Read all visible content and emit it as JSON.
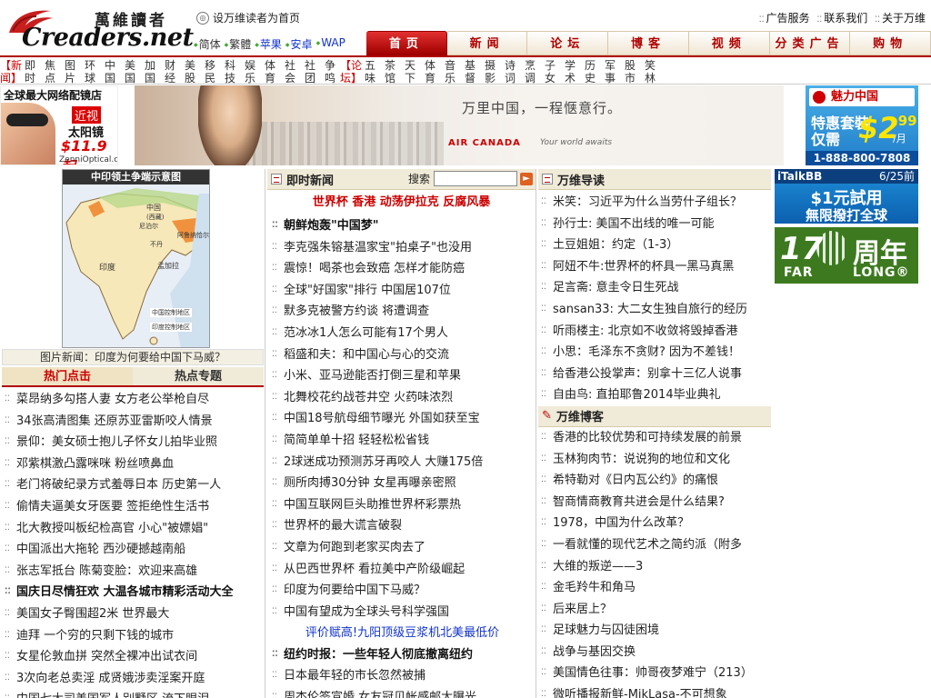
{
  "header": {
    "logo_cn": "萬維讀者",
    "logo_en": "Creaders.net",
    "set_home": "设万维读者为首页",
    "top_links": [
      "广告服务",
      "联系我们",
      "关于万维"
    ],
    "languages": [
      {
        "label": "简体",
        "color": "#333333"
      },
      {
        "label": "繁體",
        "color": "#333333"
      },
      {
        "label": "苹果",
        "color": "#1133cc"
      },
      {
        "label": "安卓",
        "color": "#1133cc"
      },
      {
        "label": "WAP",
        "color": "#1133cc"
      }
    ],
    "main_nav": [
      "首页",
      "新闻",
      "论坛",
      "博客",
      "视频",
      "分类广告",
      "购物"
    ],
    "active_nav": "首页"
  },
  "subnav": [
    {
      "label": "【新闻】",
      "red": true
    },
    {
      "label": "即时",
      "red": false
    },
    {
      "label": "焦点",
      "red": false
    },
    {
      "label": "图片",
      "red": false
    },
    {
      "label": "环球",
      "red": false
    },
    {
      "label": "中国",
      "red": false
    },
    {
      "label": "美国",
      "red": false
    },
    {
      "label": "加国",
      "red": false
    },
    {
      "label": "财经",
      "red": false
    },
    {
      "label": "美股",
      "red": false
    },
    {
      "label": "移民",
      "red": false
    },
    {
      "label": "科技",
      "red": false
    },
    {
      "label": "娱乐",
      "red": false
    },
    {
      "label": "体育",
      "red": false
    },
    {
      "label": "社会",
      "red": false
    },
    {
      "label": "社团",
      "red": false
    },
    {
      "label": "争鸣",
      "red": false
    },
    {
      "label": "【论坛】",
      "red": true
    },
    {
      "label": "五味",
      "red": false
    },
    {
      "label": "茶馆",
      "red": false
    },
    {
      "label": "天下",
      "red": false
    },
    {
      "label": "体育",
      "red": false
    },
    {
      "label": "音乐",
      "red": false
    },
    {
      "label": "基督",
      "red": false
    },
    {
      "label": "摄影",
      "red": false
    },
    {
      "label": "诗词",
      "red": false
    },
    {
      "label": "烹调",
      "red": false
    },
    {
      "label": "子女",
      "red": false
    },
    {
      "label": "学术",
      "red": false
    },
    {
      "label": "历史",
      "red": false
    },
    {
      "label": "军事",
      "red": false
    },
    {
      "label": "股市",
      "red": false
    },
    {
      "label": "笑林",
      "red": false
    }
  ],
  "ads": {
    "glasses": {
      "title": "全球最大网络配镜店",
      "near": "近视",
      "sun": "太阳镜",
      "price": "$11.9 起",
      "site": "ZenniOptical.com"
    },
    "aircanada": {
      "slogan": "万里中国，一程惬意行。",
      "brand": "AIR CANADA",
      "tagline": "Your world awaits"
    },
    "phone": {
      "logo": "魅力中国",
      "l1": "特惠套裝",
      "l2": "仅需",
      "price": "$2",
      "cents": ".99",
      "unit": "/月",
      "tel": "1-888-800-7808"
    },
    "italk": {
      "title": "iTalkBB",
      "date": "6/25前",
      "l1": "$1元試用",
      "l2": "無限撥打全球"
    },
    "farlong": {
      "num": "17",
      "year": "周年",
      "far": "FAR",
      "long": "LONG®"
    }
  },
  "left": {
    "map_title": "中印领土争端示意图",
    "map_labels": [
      "中国",
      "(西藏)",
      "印度",
      "孟加拉",
      "尼泊尔",
      "不丹",
      "阿鲁纳恰尔邦",
      "斯里兰卡",
      "巴基斯坦",
      "阿克赛钦"
    ],
    "map_legend": [
      "中国控制地区",
      "印度控制地区"
    ],
    "caption": "图片新闻：印度为何要给中国下马威？",
    "tabs": [
      "热门点击",
      "热点专题"
    ],
    "items": [
      {
        "text": "菜昂纳多勾搭人妻 女方老公举枪自尽",
        "bold": false
      },
      {
        "text": "34张高清图集 还原苏亚雷斯咬人情景",
        "bold": false
      },
      {
        "text": "景仰：美女硕士抱儿子怀女儿拍毕业照",
        "bold": false
      },
      {
        "text": "邓紫棋激凸露咪咪 粉丝喷鼻血",
        "bold": false
      },
      {
        "text": "老门将破纪录方式羞辱日本 历史第一人",
        "bold": false
      },
      {
        "text": "偷情夫逼美女牙医要 签拒绝性生活书",
        "bold": false
      },
      {
        "text": "北大教授叫板纪检高官 小心\"被嫖娼\"",
        "bold": false
      },
      {
        "text": "中国派出大拖轮 西沙硬撼越南船",
        "bold": false
      },
      {
        "text": "张志军抵台 陈菊变脸：欢迎来高雄",
        "bold": false
      },
      {
        "text": "国庆日尽情狂欢 大温各城市精彩活动大全",
        "bold": true
      },
      {
        "text": "美国女子臀围超2米 世界最大",
        "bold": false
      },
      {
        "text": "迪拜 一个穷的只剩下钱的城市",
        "bold": false
      },
      {
        "text": "女星伦敦血拼 突然全裸冲出试衣间",
        "bold": false
      },
      {
        "text": "3次向老总卖淫 成贤娥涉卖淫案开庭",
        "bold": false
      },
      {
        "text": "中国七大司美国军人别墅区 流下眼泪",
        "bold": false
      }
    ]
  },
  "center": {
    "header": "即时新闻",
    "search_label": "搜索",
    "search_placeholder": "",
    "hotline": "世界杯 香港 动荡伊拉克 反腐风暴",
    "items": [
      {
        "text": "朝鲜炮轰\"中国梦\"",
        "style": "b"
      },
      {
        "text": "李克强朱镕基温家宝\"拍桌子\"也没用",
        "style": ""
      },
      {
        "text": "震惊！喝茶也会致癌 怎样才能防癌",
        "style": ""
      },
      {
        "text": "全球\"好国家\"排行 中国居107位",
        "style": ""
      },
      {
        "text": "默多克被警方约谈 将遭调查",
        "style": ""
      },
      {
        "text": "范冰冰1人怎么可能有17个男人",
        "style": ""
      },
      {
        "text": "稻盛和夫：和中国心与心的交流",
        "style": ""
      },
      {
        "text": "小米、亚马逊能否打倒三星和苹果",
        "style": ""
      },
      {
        "text": "北舞校花约战苍井空 火药味浓烈",
        "style": ""
      },
      {
        "text": "中国18号航母细节曝光 外国如获至宝",
        "style": ""
      },
      {
        "text": "简简单单十招 轻轻松松省钱",
        "style": ""
      },
      {
        "text": "2球迷成功预测苏牙再咬人 大赚175倍",
        "style": ""
      },
      {
        "text": "厕所肉搏30分钟 女星再曝亲密照",
        "style": ""
      },
      {
        "text": "中国互联网巨头助推世界杯彩票热",
        "style": ""
      },
      {
        "text": "世界杯的最大谎言破裂",
        "style": ""
      },
      {
        "text": "文章为何跑到老家买肉去了",
        "style": ""
      },
      {
        "text": "从巴西世界杯 看拉美中产阶级崛起",
        "style": ""
      },
      {
        "text": "印度为何要给中国下马威？",
        "style": ""
      },
      {
        "text": "中国有望成为全球头号科学强国",
        "style": ""
      },
      {
        "text": "评价赋高!九阳顶级豆浆机北美最低价",
        "style": "blue"
      },
      {
        "text": "纽约时报：一些年轻人彻底撤离纽约",
        "style": "b"
      },
      {
        "text": "日本最年轻的市长忽然被捕",
        "style": ""
      },
      {
        "text": "周杰伦签宣婚 女友冠贝帐感邮大曝光",
        "style": ""
      }
    ]
  },
  "right": {
    "header1": "万维导读",
    "items1": [
      "米笑：习近平为什么当劳什子组长？",
      "孙行士: 美国不出线的唯一可能",
      "土豆姐姐：约定（1-3）",
      "阿妞不牛:世界杯的杯具一黑马真黑",
      "足言斋: 意圭令日生死战",
      "sansan33: 大二女生独自旅行的经历",
      "听雨楼主: 北京如不收敛将毁掉香港",
      "小思：毛泽东不贪财? 因为不差钱！",
      "给香港公投掌声：别拿十三亿人说事",
      "自由鸟: 直拍耶鲁2014毕业典礼"
    ],
    "header2": "万维博客",
    "items2": [
      "香港的比较优势和可持续发展的前景",
      "玉林狗肉节：说说狗的地位和文化",
      "希特勒对《日内瓦公约》的痛恨",
      "智商情商教育共进会是什么结果?",
      "1978，中国为什么改革？",
      "一看就懂的现代艺术之简约派（附多",
      "大维的叛逆——3",
      "金毛羚牛和角马",
      "后来居上？",
      "足球魅力与囚徒困境",
      "战争与基因交换",
      "美国情色往事：帅哥夜梦难宁（213）",
      "微听播报新鲜-MikLasa-不可想象"
    ]
  }
}
